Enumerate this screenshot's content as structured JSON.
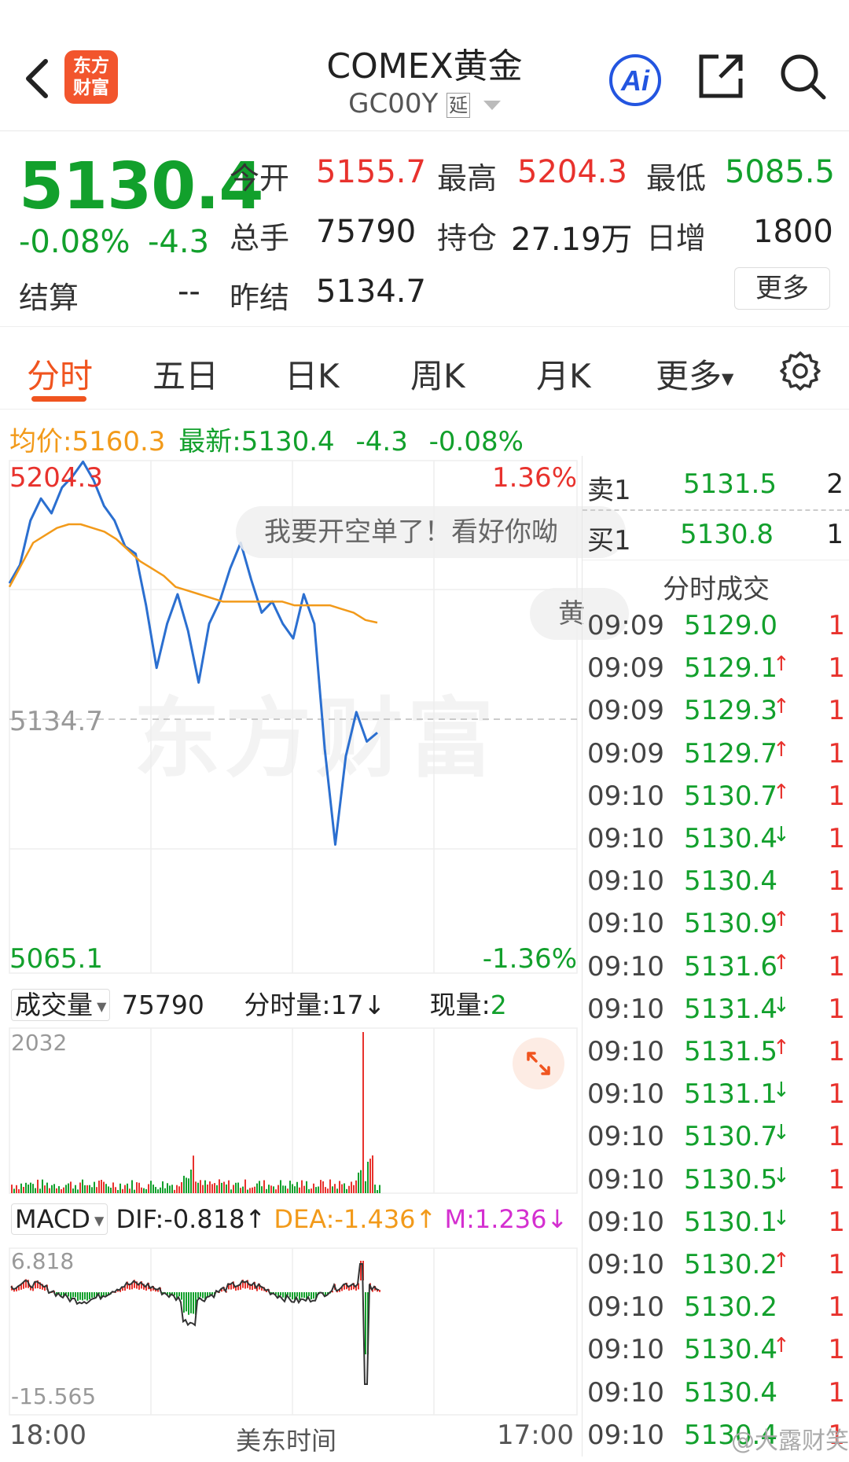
{
  "header": {
    "logo_text_1": "东方",
    "logo_text_2": "财富",
    "title": "COMEX黄金",
    "code": "GC00Y",
    "delay_tag": "延"
  },
  "quote": {
    "price": "5130.4",
    "change_pct": "-0.08%",
    "change": "-4.3",
    "open_label": "今开",
    "open": "5155.7",
    "high_label": "最高",
    "high": "5204.3",
    "low_label": "最低",
    "low": "5085.5",
    "volume_label": "总手",
    "volume": "75790",
    "oi_label": "持仓",
    "oi": "27.19万",
    "daily_inc_label": "日增",
    "daily_inc": "1800",
    "settle_label": "结算",
    "settle": "--",
    "prev_settle_label": "昨结",
    "prev_settle": "5134.7",
    "more_label": "更多"
  },
  "tabs": [
    "分时",
    "五日",
    "日K",
    "周K",
    "月K",
    "更多"
  ],
  "avg_row": {
    "avg_label": "均价:",
    "avg": "5160.3",
    "latest_label": "最新:",
    "latest": "5130.4",
    "change": "-4.3",
    "pct": "-0.08%"
  },
  "chart": {
    "y_top": "5204.3",
    "y_mid": "5134.7",
    "y_bottom": "5065.1",
    "pct_top": "1.36%",
    "pct_bottom": "-1.36%",
    "bubble_1": "我要开空单了！看好你呦",
    "bubble_2": "黄",
    "watermark": "东方财富",
    "volume_label": "成交量",
    "volume_total": "75790",
    "tick_vol_label": "分时量:17",
    "tick_vol_arrow": "↓",
    "now_vol_label": "现量:",
    "now_vol": "2",
    "vol_max": "2032",
    "macd_label": "MACD",
    "dif": "DIF:-0.818",
    "dif_arrow": "↑",
    "dea": "DEA:-1.436",
    "dea_arrow": "↑",
    "m": "M:1.236",
    "m_arrow": "↓",
    "macd_max": "6.818",
    "macd_min": "-15.565",
    "x_start": "18:00",
    "x_mid": "美东时间",
    "x_end": "17:00"
  },
  "chart_data": {
    "type": "line",
    "title": "",
    "x_range": [
      "18:00",
      "17:00"
    ],
    "ylim": [
      5065.1,
      5204.3
    ],
    "prev_settle": 5134.7,
    "series": [
      {
        "values": [
          5171,
          5176,
          5188,
          5194,
          5190,
          5197,
          5200,
          5204,
          5199,
          5192,
          5188,
          5181,
          5179,
          5165,
          5148,
          5160,
          5168,
          5158,
          5144,
          5160,
          5166,
          5175,
          5182,
          5172,
          5163,
          5166,
          5160,
          5156,
          5168,
          5160,
          5126,
          5100,
          5124,
          5136,
          5128,
          5130.4
        ]
      },
      {
        "values": [
          5170,
          5176,
          5182,
          5184,
          5186,
          5187,
          5187,
          5186,
          5185,
          5183,
          5180,
          5177,
          5175,
          5173,
          5170,
          5169,
          5168,
          5167,
          5166,
          5166,
          5166,
          5166,
          5166,
          5166,
          5165,
          5165,
          5165,
          5165,
          5164,
          5163,
          5161,
          5160.3
        ]
      }
    ]
  },
  "book": {
    "sell_label": "卖1",
    "sell_price": "5131.5",
    "sell_qty": "2",
    "buy_label": "买1",
    "buy_price": "5130.8",
    "buy_qty": "1",
    "trades_title": "分时成交",
    "trades": [
      {
        "time": "09:09",
        "price": "5129.0",
        "arrow": "",
        "vol": "1"
      },
      {
        "time": "09:09",
        "price": "5129.1",
        "arrow": "↑",
        "vol": "1"
      },
      {
        "time": "09:09",
        "price": "5129.3",
        "arrow": "↑",
        "vol": "1"
      },
      {
        "time": "09:09",
        "price": "5129.7",
        "arrow": "↑",
        "vol": "1"
      },
      {
        "time": "09:10",
        "price": "5130.7",
        "arrow": "↑",
        "vol": "1"
      },
      {
        "time": "09:10",
        "price": "5130.4",
        "arrow": "↓",
        "vol": "1"
      },
      {
        "time": "09:10",
        "price": "5130.4",
        "arrow": "",
        "vol": "1"
      },
      {
        "time": "09:10",
        "price": "5130.9",
        "arrow": "↑",
        "vol": "1"
      },
      {
        "time": "09:10",
        "price": "5131.6",
        "arrow": "↑",
        "vol": "1"
      },
      {
        "time": "09:10",
        "price": "5131.4",
        "arrow": "↓",
        "vol": "1"
      },
      {
        "time": "09:10",
        "price": "5131.5",
        "arrow": "↑",
        "vol": "1"
      },
      {
        "time": "09:10",
        "price": "5131.1",
        "arrow": "↓",
        "vol": "1"
      },
      {
        "time": "09:10",
        "price": "5130.7",
        "arrow": "↓",
        "vol": "1"
      },
      {
        "time": "09:10",
        "price": "5130.5",
        "arrow": "↓",
        "vol": "1"
      },
      {
        "time": "09:10",
        "price": "5130.1",
        "arrow": "↓",
        "vol": "1"
      },
      {
        "time": "09:10",
        "price": "5130.2",
        "arrow": "↑",
        "vol": "1"
      },
      {
        "time": "09:10",
        "price": "5130.2",
        "arrow": "",
        "vol": "1"
      },
      {
        "time": "09:10",
        "price": "5130.4",
        "arrow": "↑",
        "vol": "1"
      },
      {
        "time": "09:10",
        "price": "5130.4",
        "arrow": "",
        "vol": "1"
      },
      {
        "time": "09:10",
        "price": "5130.4",
        "arrow": "",
        "vol": "1"
      }
    ]
  },
  "credit": "@大露财笑",
  "colors": {
    "up": "#e8322d",
    "down": "#12a02c",
    "avg": "#f29a1a",
    "price_line": "#2b6fd0",
    "accent": "#f0541f"
  }
}
